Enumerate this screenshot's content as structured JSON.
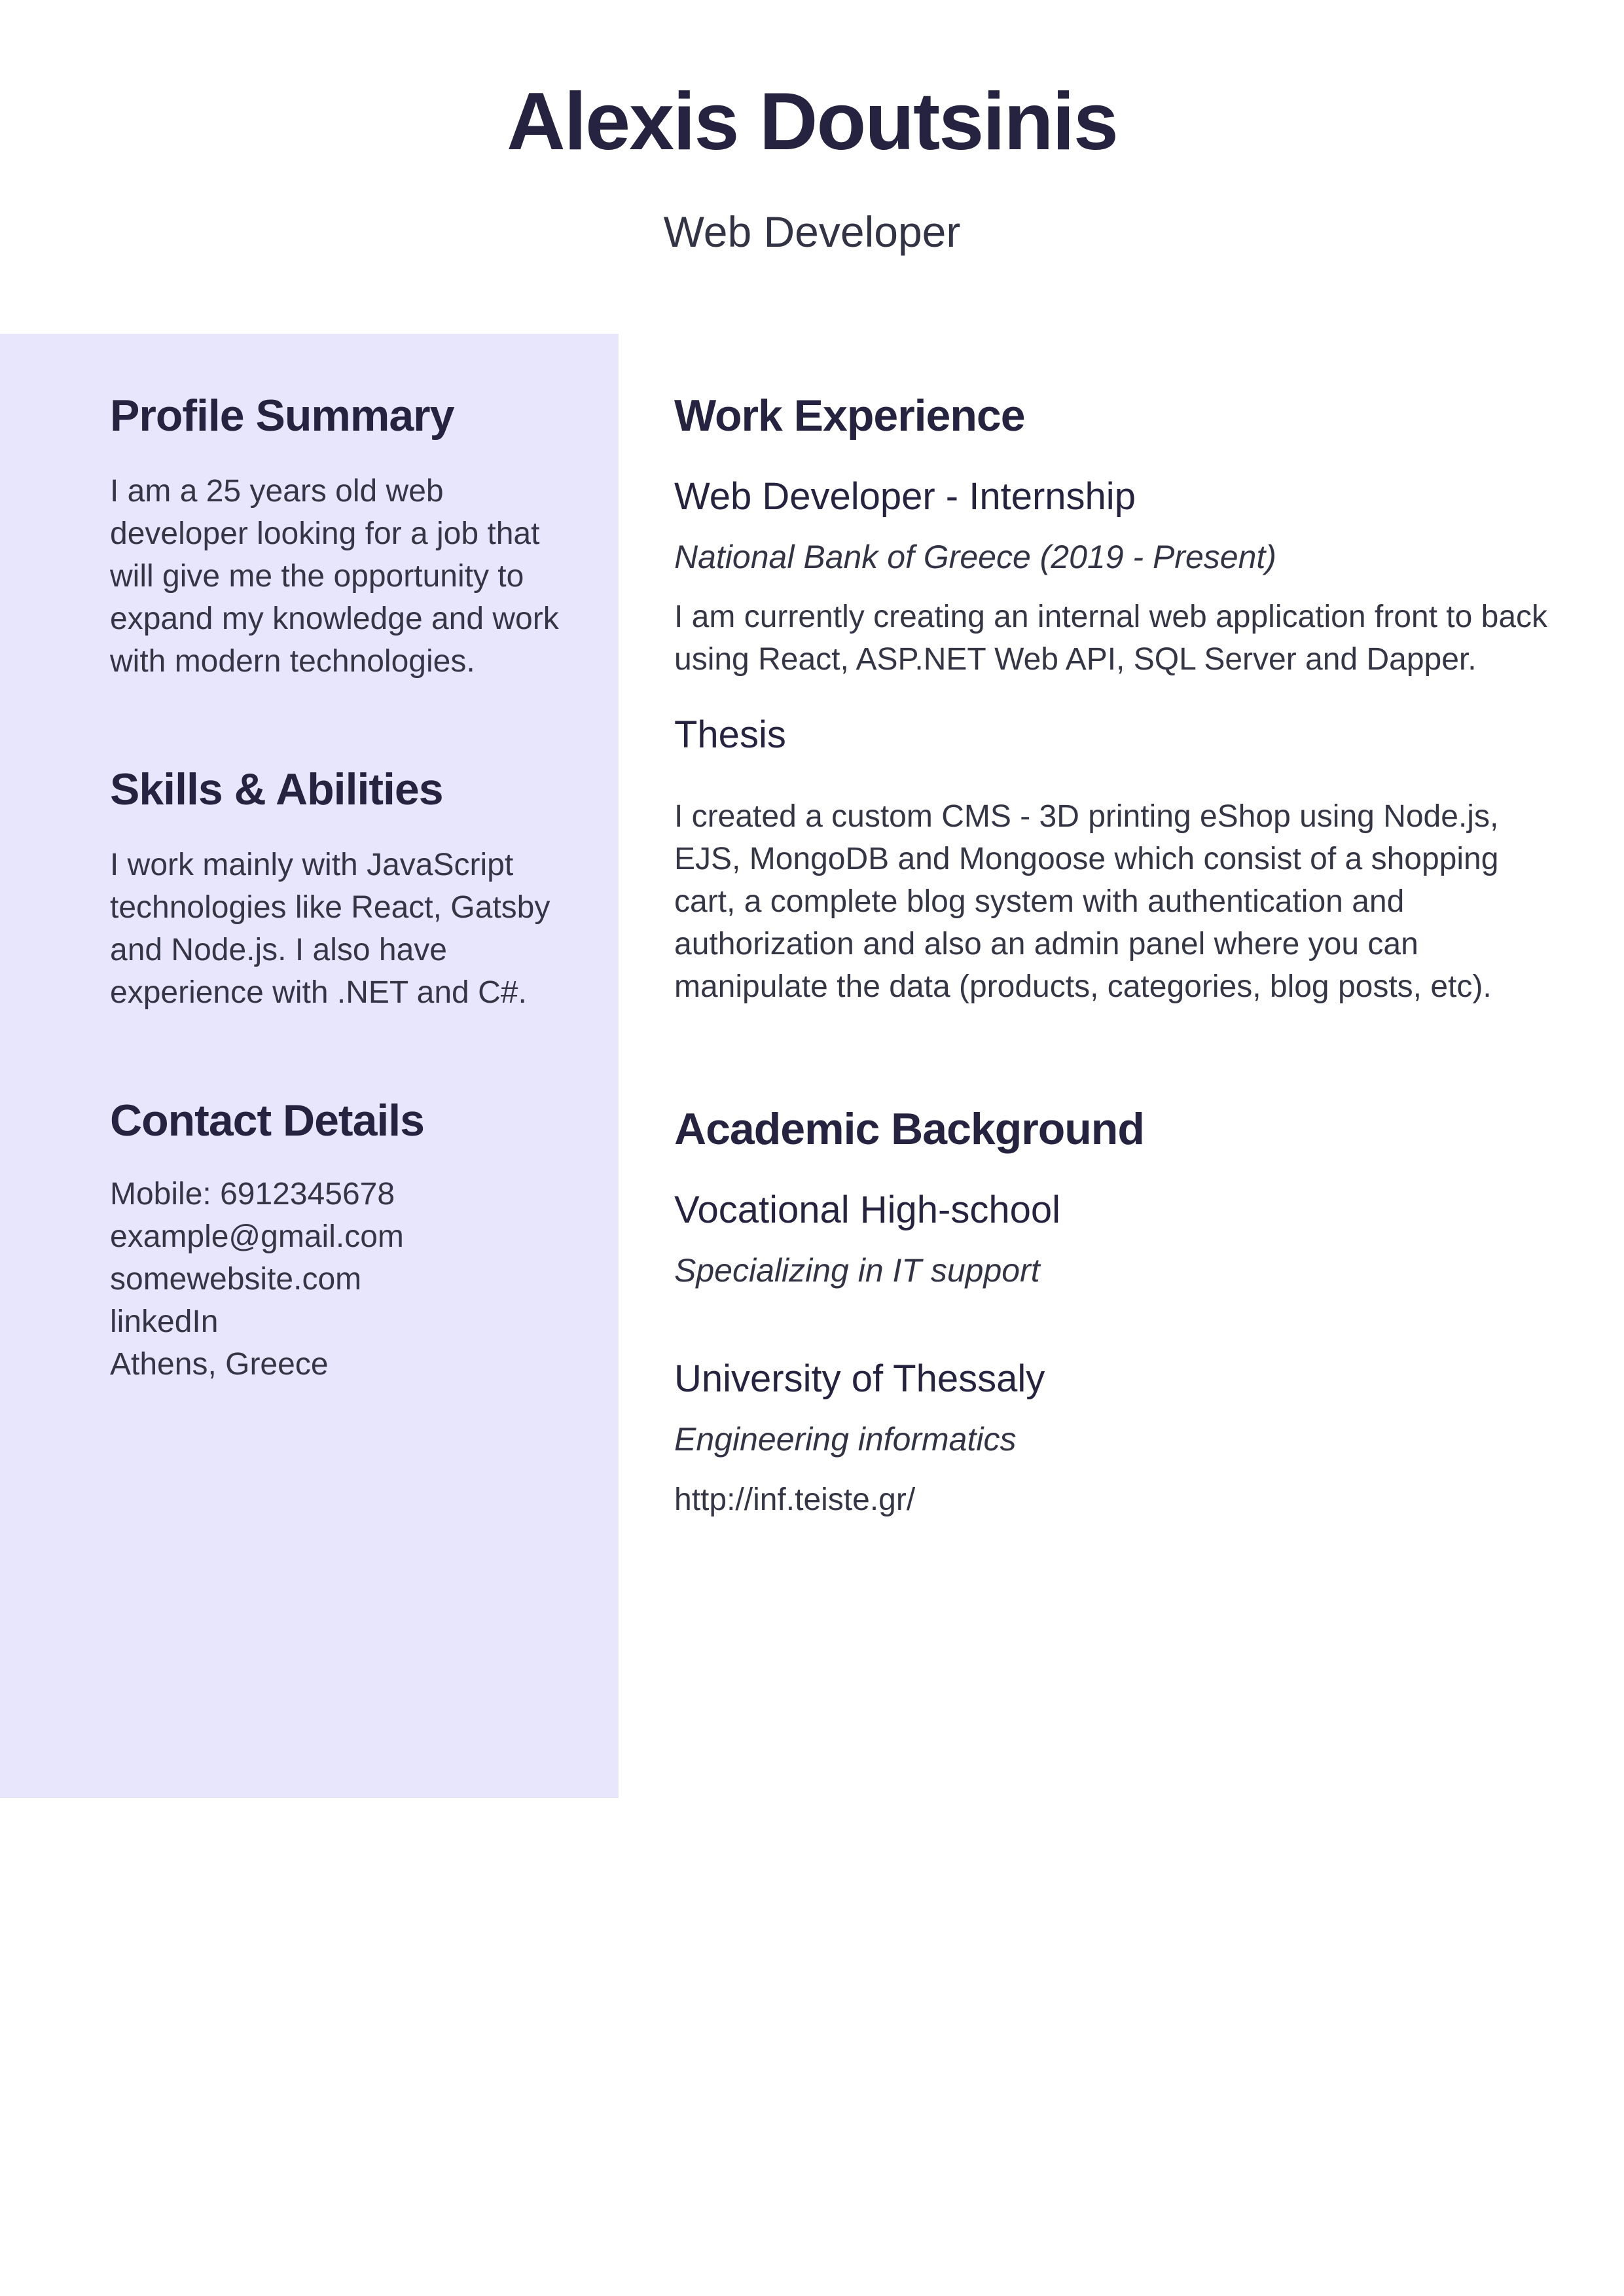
{
  "header": {
    "name": "Alexis Doutsinis",
    "role": "Web Developer"
  },
  "sidebar": {
    "profile": {
      "title": "Profile Summary",
      "text": "I am a 25 years old web developer looking for a job that will give me the opportunity to expand my knowledge and work with modern technologies."
    },
    "skills": {
      "title": "Skills & Abilities",
      "text": "I work mainly with JavaScript technologies like React, Gatsby and Node.js. I also have experience with .NET and C#."
    },
    "contact": {
      "title": "Contact Details",
      "mobile": "Mobile: 6912345678",
      "email": "example@gmail.com",
      "website": "somewebsite.com",
      "linkedin": "linkedIn",
      "location": "Athens, Greece"
    }
  },
  "main": {
    "work": {
      "title": "Work Experience",
      "job_title": "Web Developer - Internship",
      "company": "National Bank of Greece (2019 - Present)",
      "description": "I am currently creating an internal web application front to back using React, ASP.NET Web API, SQL Server and Dapper.",
      "thesis_title": "Thesis",
      "thesis_text": "I created a custom CMS - 3D printing eShop using Node.js, EJS, MongoDB and Mongoose which consist of a shopping cart, a complete blog system with authentication and authorization and also an admin panel where you can manipulate the data (products, categories, blog posts, etc)."
    },
    "academic": {
      "title": "Academic Background",
      "school_1": "Vocational High-school",
      "school_1_detail": "Specializing in IT support",
      "school_2": "University of Thessaly",
      "school_2_detail": "Engineering informatics",
      "school_2_link": "http://inf.teiste.gr/"
    }
  }
}
